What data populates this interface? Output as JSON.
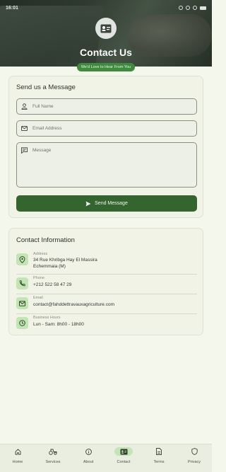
{
  "status_bar": {
    "time": "16:01"
  },
  "header": {
    "title": "Contact Us",
    "tagline": "We'd Love to Hear From You",
    "icon": "contact-card-icon"
  },
  "message_form": {
    "title": "Send us a Message",
    "full_name_placeholder": "Full Name",
    "email_placeholder": "Email Address",
    "message_placeholder": "Message",
    "send_label": "Send Message"
  },
  "contact_info": {
    "title": "Contact Information",
    "items": [
      {
        "label": "Address",
        "value": "34 Rue Khribga Hay El Massira",
        "value2": "Echemmaia (M)",
        "icon": "location-pin-icon"
      },
      {
        "label": "Phone",
        "value": "+212 522 58 47 29",
        "icon": "phone-icon"
      },
      {
        "label": "Email",
        "value": "contact@fahddettravauxagriculture.com",
        "icon": "email-icon"
      },
      {
        "label": "Business Hours",
        "value": "Lun - Sam: 8h00 - 18h00",
        "icon": "clock-icon"
      }
    ]
  },
  "bottom_nav": {
    "active": "Contact",
    "items": [
      {
        "label": "Home",
        "icon": "home-icon"
      },
      {
        "label": "Services",
        "icon": "tractor-icon"
      },
      {
        "label": "About",
        "icon": "info-icon"
      },
      {
        "label": "Contact",
        "icon": "contact-card-icon"
      },
      {
        "label": "Terms",
        "icon": "document-icon"
      },
      {
        "label": "Privacy",
        "icon": "shield-icon"
      }
    ]
  },
  "colors": {
    "primary": "#35652f",
    "accent_green": "#3f8a3e",
    "icon_bg": "#c3e4b5",
    "background": "#f4f7ec"
  }
}
